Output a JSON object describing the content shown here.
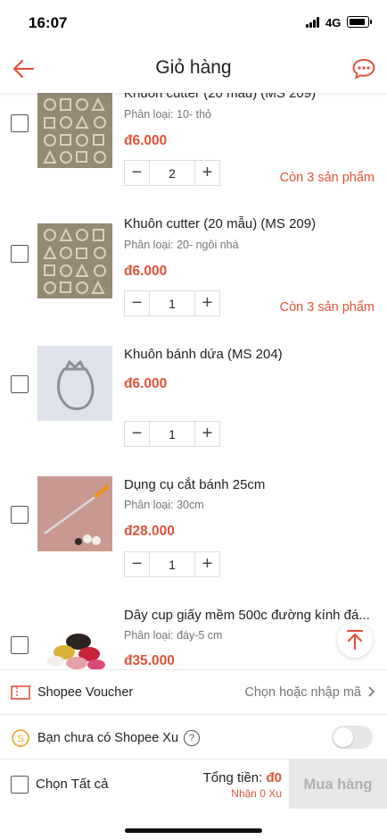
{
  "status": {
    "time": "16:07",
    "network": "4G"
  },
  "header": {
    "title": "Giỏ hàng"
  },
  "items": [
    {
      "name": "Khuôn cutter (20 mẫu) (MS 209)",
      "variant": "Phân loại: 10- thỏ",
      "price": "đ6.000",
      "qty": "2",
      "stock": "Còn 3 sản phẩm"
    },
    {
      "name": "Khuôn cutter (20 mẫu) (MS 209)",
      "variant": "Phân loại: 20- ngôi nhà",
      "price": "đ6.000",
      "qty": "1",
      "stock": "Còn 3 sản phẩm"
    },
    {
      "name": "Khuôn bánh dứa (MS 204)",
      "variant": "",
      "price": "đ6.000",
      "qty": "1",
      "stock": ""
    },
    {
      "name": "Dụng cụ cắt bánh 25cm",
      "variant": "Phân loại: 30cm",
      "price": "đ28.000",
      "qty": "1",
      "stock": ""
    },
    {
      "name": "Dây cup giấy mềm 500c đường kính đá...",
      "variant": "Phân loại: đáy-5 cm",
      "price": "đ35.000",
      "qty": "",
      "stock": ""
    }
  ],
  "qty_controls": {
    "minus": "−",
    "plus": "+"
  },
  "voucher": {
    "label": "Shopee Voucher",
    "action": "Chọn hoặc nhập mã"
  },
  "xu": {
    "label": "Bạn chưa có Shopee Xu",
    "help": "?"
  },
  "footer": {
    "select_all": "Chọn Tất cả",
    "total_label": "Tổng tiền:",
    "total_value": "đ0",
    "earn": "Nhận 0 Xu",
    "buy": "Mua hàng"
  },
  "colors": {
    "accent": "#e0533a"
  },
  "icons": [
    "back-arrow-icon",
    "chat-icon",
    "scroll-top-icon",
    "voucher-icon",
    "coin-icon",
    "chevron-right-icon"
  ]
}
